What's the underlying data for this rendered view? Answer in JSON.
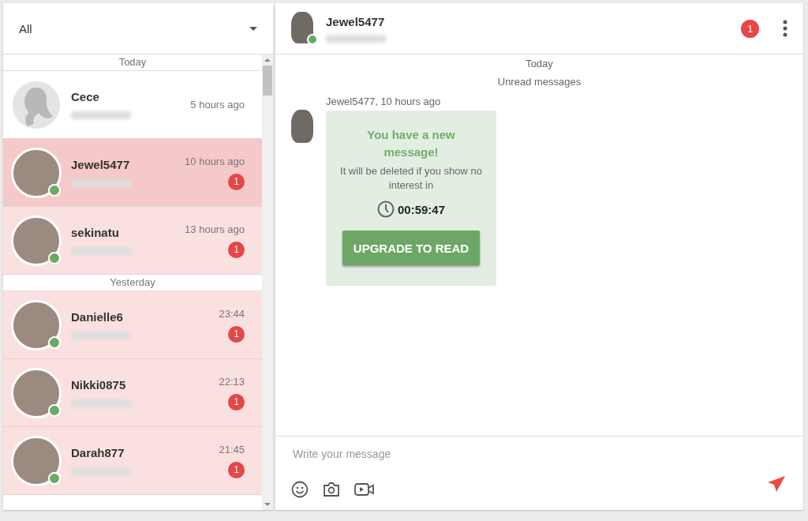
{
  "filter": {
    "value": "All"
  },
  "conversations": [
    {
      "kind": "separator",
      "label": "Today"
    },
    {
      "kind": "conversation",
      "name": "Cece",
      "time": "5 hours ago",
      "has_photo": false,
      "online": false,
      "unread": false,
      "selected": false
    },
    {
      "kind": "conversation",
      "name": "Jewel5477",
      "time": "10 hours ago",
      "badge": "1",
      "has_photo": true,
      "online": true,
      "unread": true,
      "selected": true
    },
    {
      "kind": "conversation",
      "name": "sekinatu",
      "time": "13 hours ago",
      "badge": "1",
      "has_photo": true,
      "online": true,
      "unread": true,
      "selected": false
    },
    {
      "kind": "separator",
      "label": "Yesterday"
    },
    {
      "kind": "conversation",
      "name": "Danielle6",
      "time": "23:44",
      "badge": "1",
      "has_photo": true,
      "online": true,
      "unread": true,
      "selected": false
    },
    {
      "kind": "conversation",
      "name": "Nikki0875",
      "time": "22:13",
      "badge": "1",
      "has_photo": true,
      "online": true,
      "unread": true,
      "selected": false
    },
    {
      "kind": "conversation",
      "name": "Darah877",
      "time": "21:45",
      "badge": "1",
      "has_photo": true,
      "online": true,
      "unread": true,
      "selected": false
    }
  ],
  "chat": {
    "name": "Jewel5477",
    "online": true,
    "badge": "1",
    "day": "Today",
    "unread_label": "Unread messages",
    "message": {
      "meta": "Jewel5477, 10 hours ago",
      "title": "You have a new message!",
      "text": "It will be deleted if you show no interest in",
      "timer": "00:59:47",
      "button": "UPGRADE TO READ"
    },
    "composer": {
      "placeholder": "Write your message"
    }
  }
}
